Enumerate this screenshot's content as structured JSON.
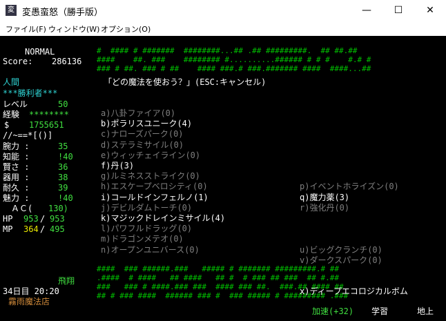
{
  "window": {
    "title": "変愚蛮怒（勝手版）",
    "app_icon": "変",
    "minimize": "—",
    "maximize": "☐",
    "close": "✕"
  },
  "menu": [
    "ファイル(F)",
    "ウィンドウ(W)",
    "オプション(O)"
  ],
  "status": {
    "mode": "NORMAL",
    "score_label": "Score:",
    "score_value": "286136",
    "race": "人間",
    "title": "***勝利者***",
    "level_label": "レベル",
    "level_value": "50",
    "exp_label": "経験",
    "exp_value": "********",
    "gold_label": "$",
    "gold_value": "1755651",
    "equip": "//~==*[()]",
    "stats": [
      {
        "label": "腕力 :",
        "value": "35"
      },
      {
        "label": "知能 :",
        "value": "!40"
      },
      {
        "label": "賢さ :",
        "value": "36"
      },
      {
        "label": "器用 :",
        "value": "38"
      },
      {
        "label": "耐久 :",
        "value": "39"
      },
      {
        "label": "魅力 :",
        "value": "!40"
      }
    ],
    "ac_label": "ＡＣ(",
    "ac_value": "130)",
    "hp_label": "HP",
    "hp_cur": "953",
    "hp_max": "953",
    "mp_label": "MP",
    "mp_cur": "364",
    "mp_max": "495",
    "flying": "飛翔",
    "day_time": "34日目 20:20",
    "location": "霧雨魔法店"
  },
  "prompt": "「どの魔法を使おう？」(ESC:キャンセル)",
  "spells_left": [
    {
      "text": "a)八卦ファイア(0)",
      "enabled": false
    },
    {
      "text": "b)ポラリスユニーク(4)",
      "enabled": true
    },
    {
      "text": "c)ナローズパーク(0)",
      "enabled": false
    },
    {
      "text": "d)ステラミサイル(0)",
      "enabled": false
    },
    {
      "text": "e)ウィッチェイライン(0)",
      "enabled": false
    },
    {
      "text": "f)丹(3)",
      "enabled": true
    },
    {
      "text": "g)ルミネスストライク(0)",
      "enabled": false
    },
    {
      "text": "h)エスケープベロシティ(0)",
      "enabled": false
    },
    {
      "text": "i)コールドインフェルノ(1)",
      "enabled": true
    },
    {
      "text": "j)デビルダムトーチ(0)",
      "enabled": false
    },
    {
      "text": "k)マジックドレインミサイル(4)",
      "enabled": true
    },
    {
      "text": "l)パワフルドラッグ(0)",
      "enabled": false
    },
    {
      "text": "m)ドラゴンメテオ(0)",
      "enabled": false
    },
    {
      "text": "n)オープンユニバース(0)",
      "enabled": false
    }
  ],
  "spells_right": [
    {
      "text": "p)イベントホライズン(0)",
      "enabled": false,
      "row": 7
    },
    {
      "text": "q)魔力薬(3)",
      "enabled": true,
      "row": 8
    },
    {
      "text": "r)強化丹(0)",
      "enabled": false,
      "row": 9
    },
    {
      "text": "u)ビッグクランチ(0)",
      "enabled": false,
      "row": 13
    },
    {
      "text": "v)ダークスパーク(0)",
      "enabled": false,
      "row": 14
    },
    {
      "text": "x)ディープエコロジカルボム",
      "enabled": true,
      "row": 17
    }
  ],
  "map_top": [
    "#  #### # #######  ########...## .## #########.  ## ##.##",
    "####    ##. ###    ######## #..........###### # # #    #.# #",
    "### # ##. ### # ##    #### ###.# ###.####### ####  ####...##"
  ],
  "map_bottom": [
    "####  ### ######.###   ##### # ####### #########.# ##",
    ".####  # ####   ## ####   ## #  # ### ## ###  ## #.##",
    "###   ### # ####.### ###  #### ### ##.  ###.## #### ##",
    "## # ### ####  ###### ### #  ### ##### # ######### .###"
  ],
  "bottom": {
    "speed": "加速(+32)",
    "study": "学習",
    "depth": "地上"
  }
}
